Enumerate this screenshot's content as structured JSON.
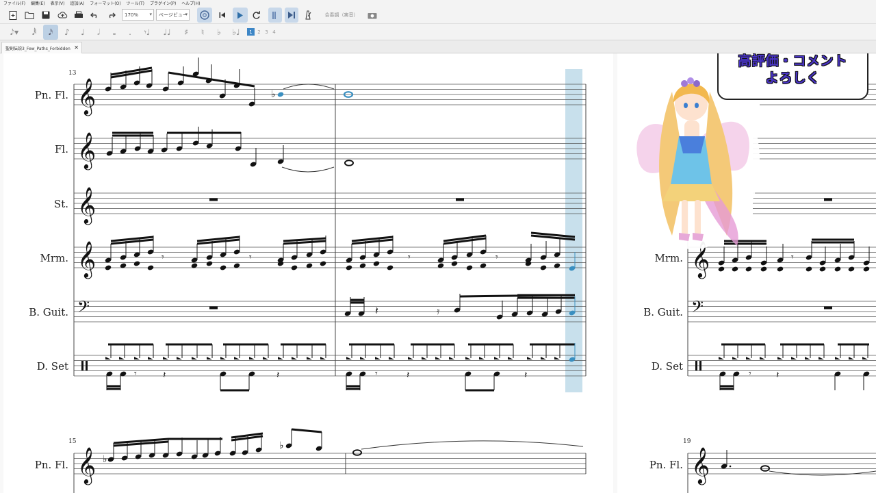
{
  "menu": [
    "ファイル(F)",
    "編集(E)",
    "表示(V)",
    "追加(A)",
    "フォーマット(O)",
    "ツール(T)",
    "プラグイン(P)",
    "ヘルプ(H)"
  ],
  "toolbar": {
    "zoom_value": "170%",
    "view_mode": "ページビュー",
    "concert_pitch": "合奏調（実音）",
    "voices": [
      "1",
      "2",
      "3",
      "4"
    ]
  },
  "tab": {
    "title": "聖剣伝説3_Few_Paths_Forbidden"
  },
  "score": {
    "measure_numbers": {
      "system1": "13",
      "system2": "15",
      "system2_right": "19"
    },
    "instruments": [
      "Pn. Fl.",
      "Fl.",
      "St.",
      "Mrm.",
      "B. Guit.",
      "D. Set"
    ],
    "right_instruments": [
      "Mrm.",
      "B. Guit.",
      "D. Set"
    ],
    "system2_instrument": "Pn. Fl.",
    "accent_color": "#3a8fc0",
    "playback_highlight_color": "#c8e0ec"
  },
  "overlay": {
    "bubble_line1": "高評価・コメント",
    "bubble_line2": "よろしく"
  }
}
